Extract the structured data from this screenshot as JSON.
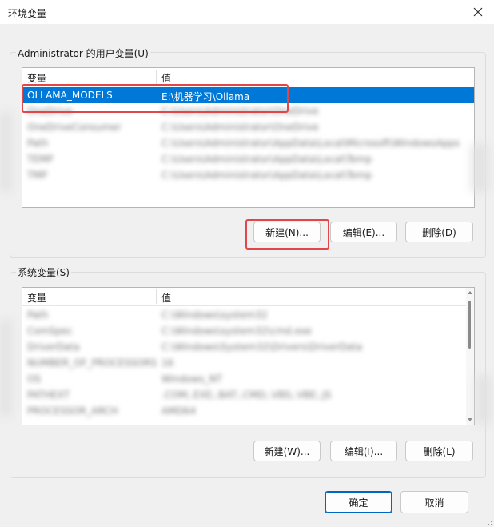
{
  "window": {
    "title": "环境变量",
    "close_icon": "close-icon"
  },
  "user_vars": {
    "group_label": "Administrator 的用户变量(U)",
    "header": {
      "name": "变量",
      "value": "值"
    },
    "rows": [
      {
        "name": "OLLAMA_MODELS",
        "value": "E:\\机器学习\\Ollama",
        "selected": true
      },
      {
        "name": "OneDrive",
        "value": "C:\\Users\\Administrator\\OneDrive",
        "blurred": true
      },
      {
        "name": "OneDriveConsumer",
        "value": "C:\\Users\\Administrator\\OneDrive",
        "blurred": true
      },
      {
        "name": "Path",
        "value": "C:\\Users\\Administrator\\AppData\\Local\\Microsoft\\WindowsApps",
        "blurred": true
      },
      {
        "name": "TEMP",
        "value": "C:\\Users\\Administrator\\AppData\\Local\\Temp",
        "blurred": true
      },
      {
        "name": "TMP",
        "value": "C:\\Users\\Administrator\\AppData\\Local\\Temp",
        "blurred": true
      }
    ],
    "buttons": {
      "new": "新建(N)...",
      "edit": "编辑(E)...",
      "delete": "删除(D)"
    }
  },
  "system_vars": {
    "group_label": "系统变量(S)",
    "header": {
      "name": "变量",
      "value": "值"
    },
    "rows": [
      {
        "name": "Path",
        "value": "C:\\Windows\\system32",
        "blurred": true
      },
      {
        "name": "ComSpec",
        "value": "C:\\Windows\\system32\\cmd.exe",
        "blurred": true
      },
      {
        "name": "DriverData",
        "value": "C:\\Windows\\System32\\Drivers\\DriverData",
        "blurred": true
      },
      {
        "name": "NUMBER_OF_PROCESSORS",
        "value": "16",
        "blurred": true
      },
      {
        "name": "OS",
        "value": "Windows_NT",
        "blurred": true
      },
      {
        "name": "PATHEXT",
        "value": ".COM;.EXE;.BAT;.CMD;.VBS;.VBE;.JS",
        "blurred": true
      },
      {
        "name": "PROCESSOR_ARCH",
        "value": "AMD64",
        "blurred": true
      }
    ],
    "buttons": {
      "new": "新建(W)...",
      "edit": "编辑(I)...",
      "delete": "删除(L)"
    }
  },
  "footer": {
    "ok": "确定",
    "cancel": "取消"
  }
}
